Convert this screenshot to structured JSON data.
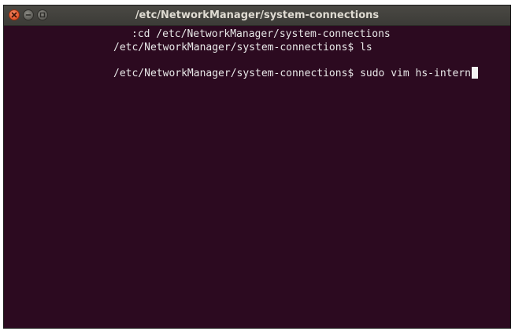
{
  "window": {
    "title": "/etc/NetworkManager/system-connections"
  },
  "terminal": {
    "lines": [
      "cd /etc/NetworkManager/system-connections",
      "/etc/NetworkManager/system-connections$ ls",
      "/etc/NetworkManager/system-connections$ sudo vim hs-intern"
    ],
    "line1_prefix": ":"
  },
  "colors": {
    "terminal_bg": "#2c0a20",
    "titlebar_bg": "#3c3b37",
    "text": "#e8e8e8",
    "close_button": "#e2552b"
  },
  "icons": [
    "close-icon",
    "minimize-icon",
    "maximize-icon"
  ]
}
